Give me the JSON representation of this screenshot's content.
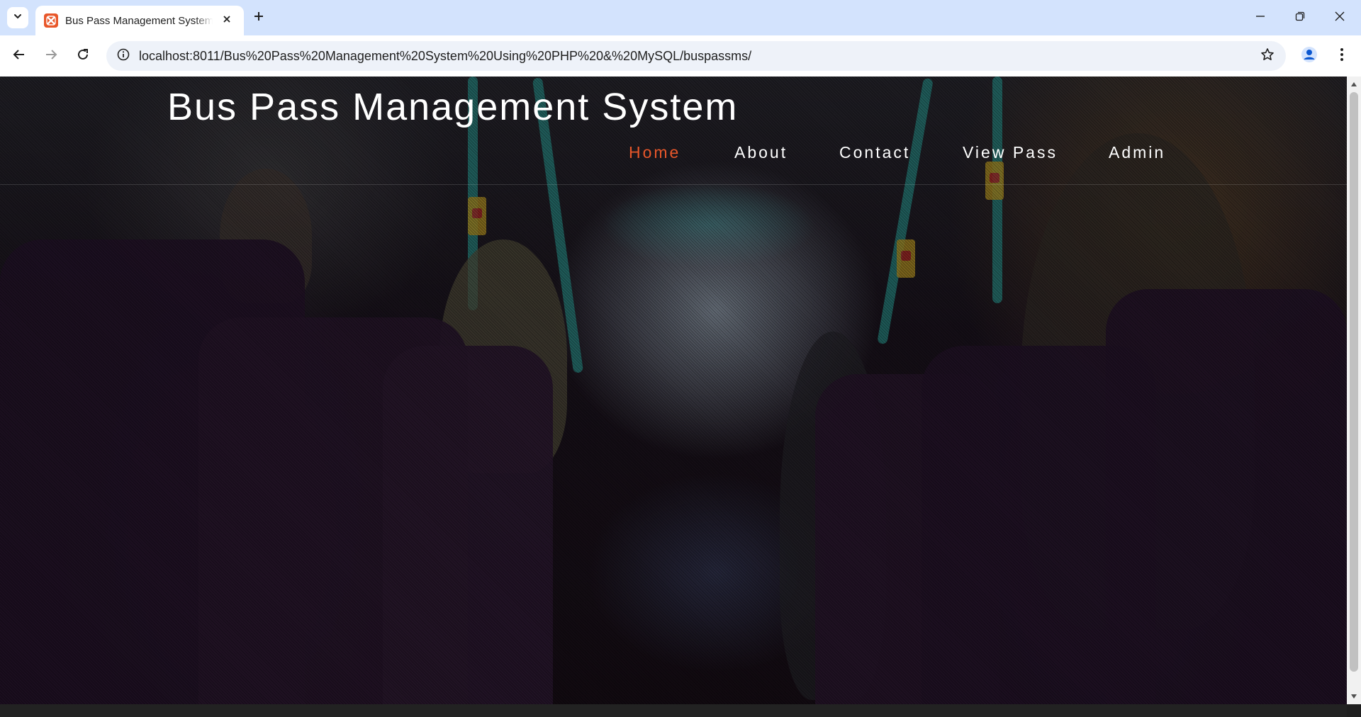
{
  "browser": {
    "tab_title": "Bus Pass Management System | Home Page",
    "url": "localhost:8011/Bus%20Pass%20Management%20System%20Using%20PHP%20&%20MySQL/buspassms/",
    "favicon_color": "#e8572a",
    "tabstrip_color": "#d3e3fd"
  },
  "site": {
    "title": "Bus Pass Management System",
    "nav": [
      {
        "label": "Home",
        "active": true
      },
      {
        "label": "About",
        "active": false
      },
      {
        "label": "Contact",
        "active": false
      },
      {
        "label": "View Pass",
        "active": false
      },
      {
        "label": "Admin",
        "active": false
      }
    ],
    "accent_color": "#e8572a"
  },
  "icons": {
    "tab_search": "chevron-down-icon",
    "favicon": "xampp-icon",
    "tab_close": "close-icon",
    "new_tab": "plus-icon",
    "minimize": "minimize-icon",
    "restore": "restore-icon",
    "close_window": "close-icon",
    "back": "arrow-left-icon",
    "forward": "arrow-right-icon",
    "reload": "reload-icon",
    "site_info": "info-icon",
    "bookmark": "star-icon",
    "profile": "person-icon",
    "menu": "kebab-menu-icon"
  }
}
